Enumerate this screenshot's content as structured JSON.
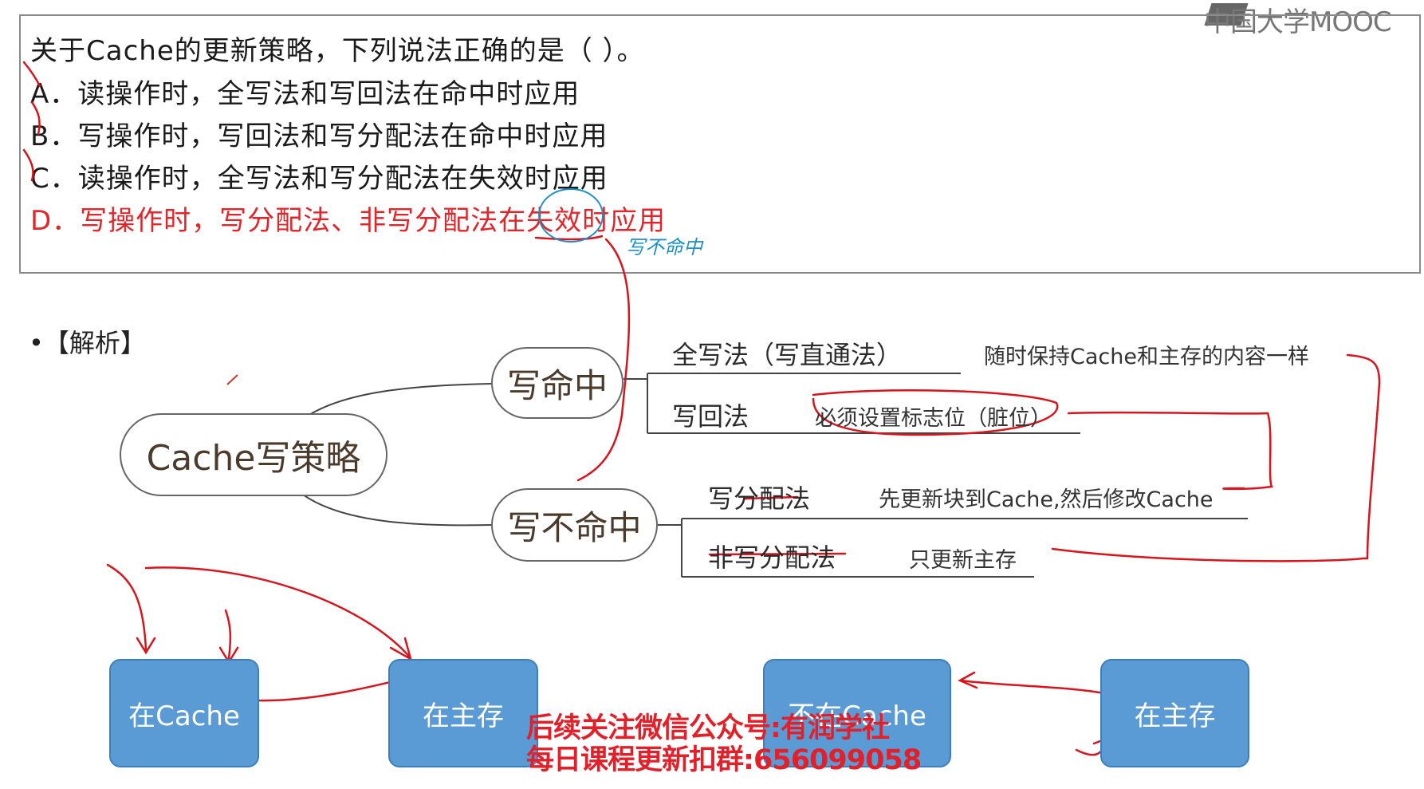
{
  "logo": {
    "text": "中国大学MOOC"
  },
  "question": {
    "stem": "关于Cache的更新策略，下列说法正确的是（    ）。",
    "options": [
      {
        "text": "A．读操作时，全写法和写回法在命中时应用",
        "correct": false
      },
      {
        "text": "B．写操作时，写回法和写分配法在命中时应用",
        "correct": false
      },
      {
        "text": "C．读操作时，全写法和写分配法在失效时应用",
        "correct": false
      },
      {
        "text": "D．写操作时，写分配法、非写分配法在失效时应用",
        "correct": true
      }
    ],
    "annotation": "写不命中"
  },
  "analysis": {
    "label": "•【解析】"
  },
  "mindmap": {
    "root": "Cache写策略",
    "hit": {
      "label": "写命中",
      "leaves": [
        {
          "label": "全写法（写直通法）",
          "desc": "随时保持Cache和主存的内容一样"
        },
        {
          "label": "写回法",
          "desc": "必须设置标志位（脏位）"
        }
      ]
    },
    "miss": {
      "label": "写不命中",
      "leaves": [
        {
          "label": "写分配法",
          "desc": "先更新块到Cache,然后修改Cache"
        },
        {
          "label": "非写分配法",
          "desc": "只更新主存"
        }
      ]
    }
  },
  "boxes": [
    {
      "label": "在Cache"
    },
    {
      "label": "在主存"
    },
    {
      "label": "不在Cache"
    },
    {
      "label": "在主存"
    }
  ],
  "watermark": {
    "line1": "后续关注微信公众号:有润学社",
    "line2": "每日课程更新扣群:656099058"
  },
  "colors": {
    "answer_red": "#e0262a",
    "box_blue": "#5b9bd5",
    "annotation_blue": "#1e90c8",
    "ink_red": "#d8141c"
  }
}
